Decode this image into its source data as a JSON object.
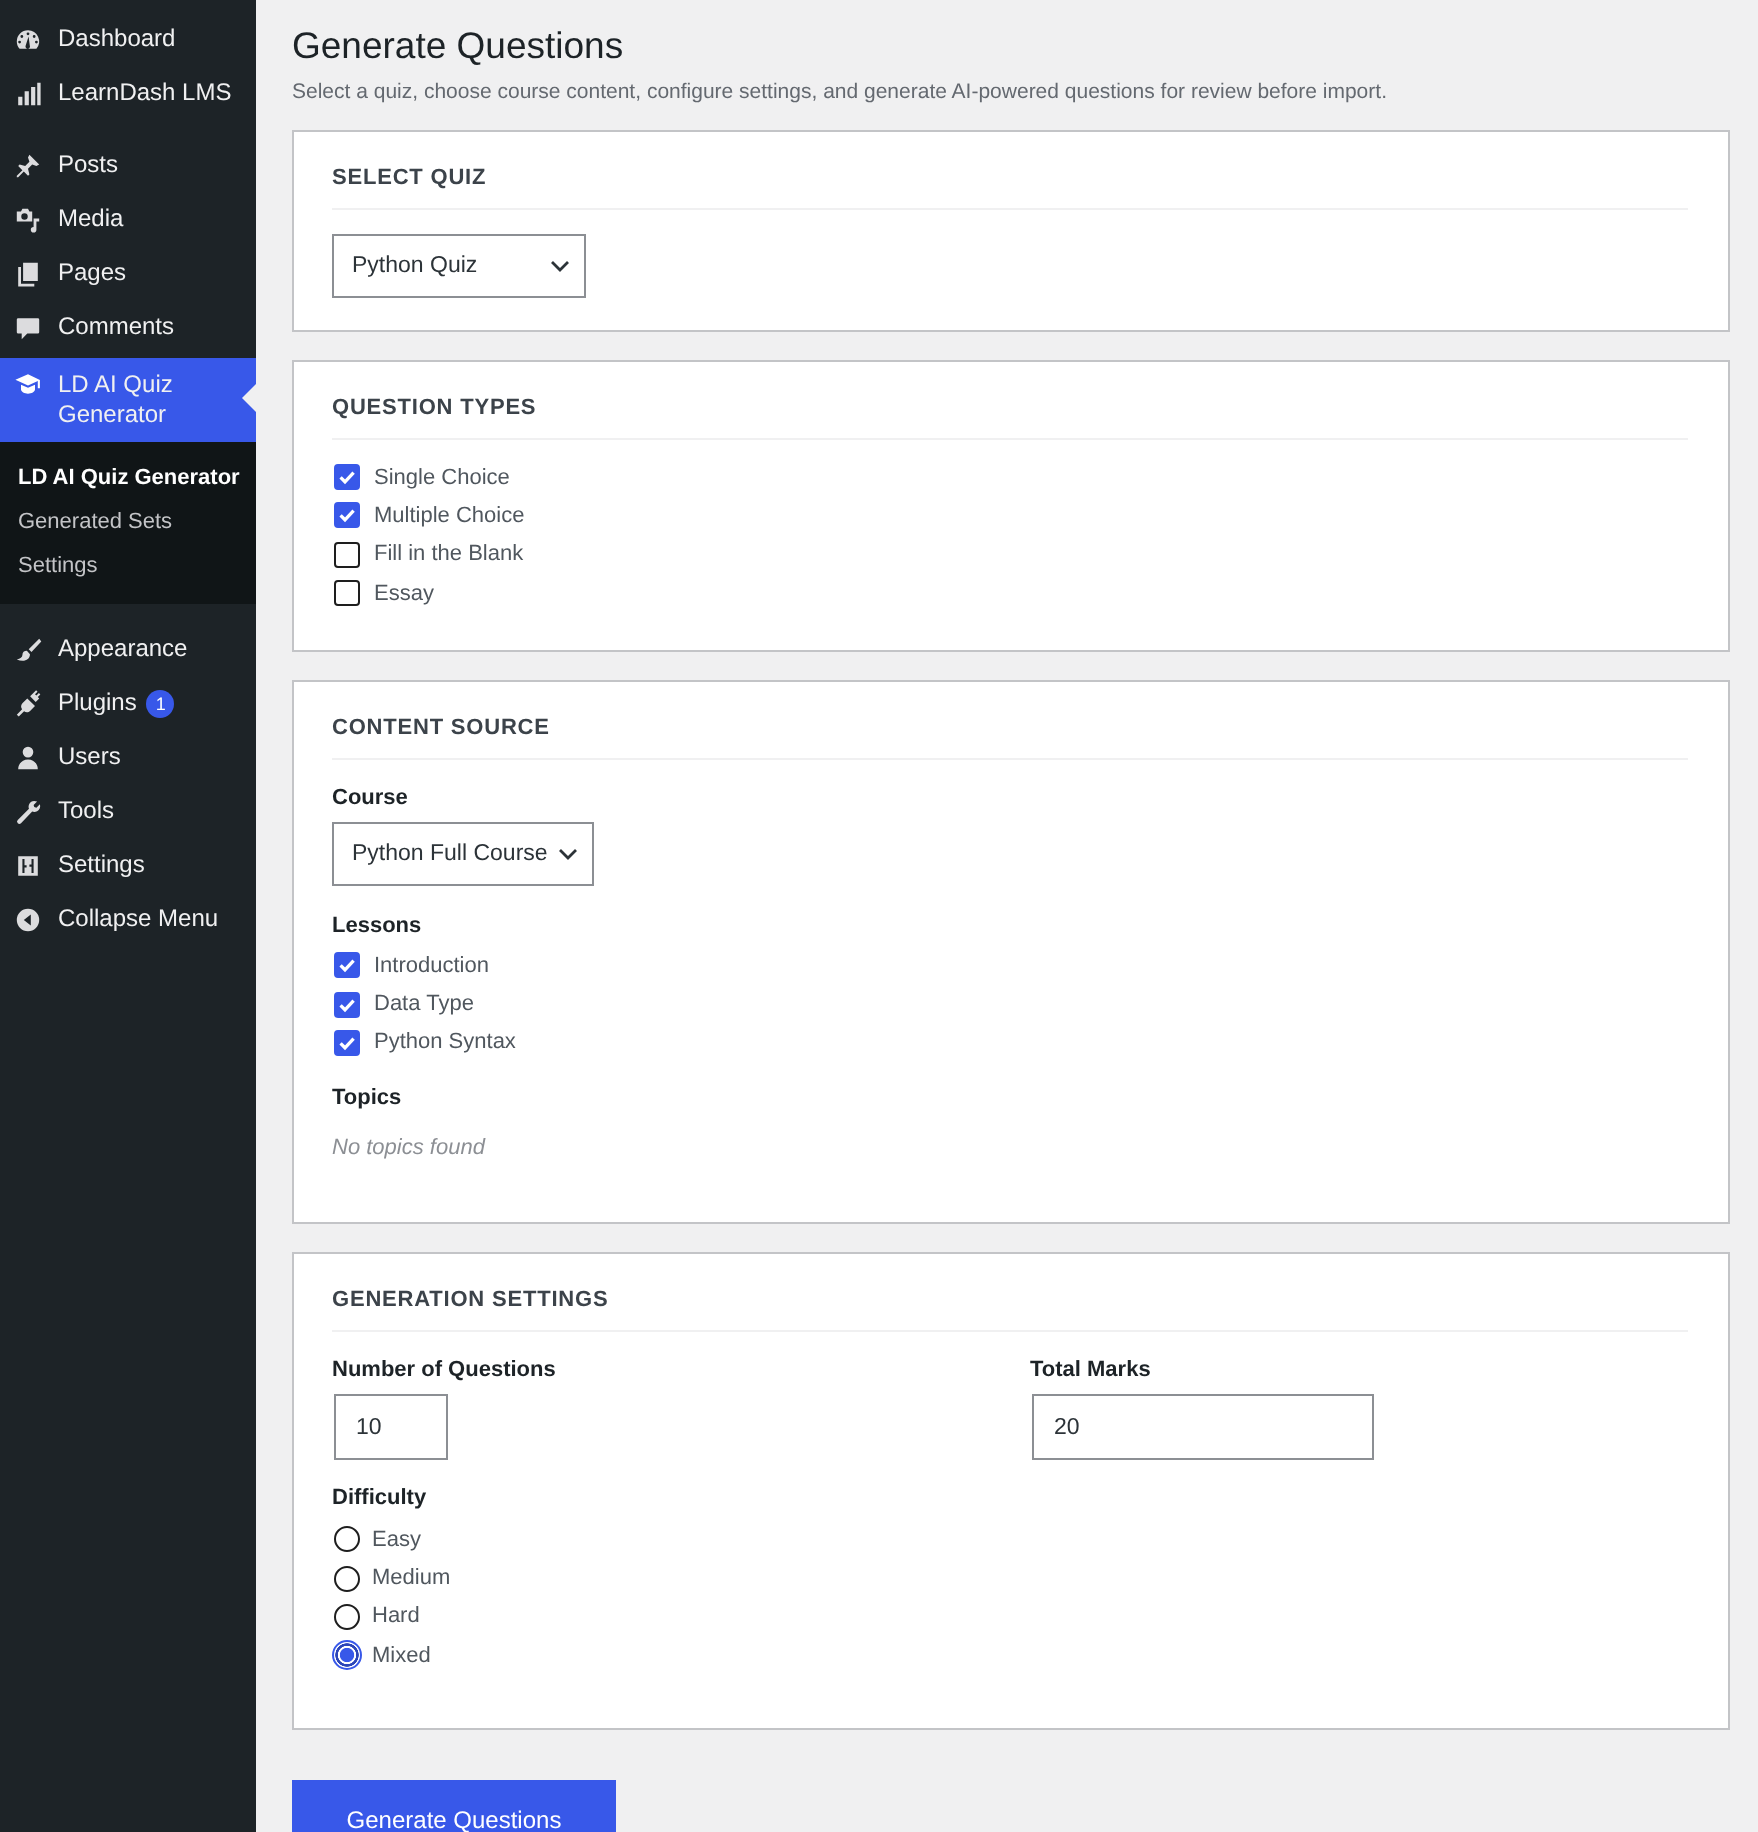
{
  "sidebar": {
    "groups": [
      {
        "items": [
          {
            "label": "Dashboard",
            "selected": false
          },
          {
            "label": "LearnDash LMS",
            "selected": false
          }
        ]
      },
      {
        "items": [
          {
            "label": "Posts",
            "selected": false
          },
          {
            "label": "Media",
            "selected": false
          },
          {
            "label": "Pages",
            "selected": false
          },
          {
            "label": "Comments",
            "selected": false
          },
          {
            "label": "LD AI Quiz Generator",
            "selected": true,
            "submenu": [
              {
                "label": "LD AI Quiz Generator",
                "selected": true
              },
              {
                "label": "Generated Sets",
                "selected": false
              },
              {
                "label": "Settings",
                "selected": false
              }
            ]
          }
        ]
      },
      {
        "items": [
          {
            "label": "Appearance",
            "selected": false
          },
          {
            "label": "Plugins",
            "selected": false,
            "badge": "1"
          },
          {
            "label": "Users",
            "selected": false
          },
          {
            "label": "Tools",
            "selected": false
          },
          {
            "label": "Settings",
            "selected": false
          },
          {
            "label": "Collapse Menu",
            "selected": false
          }
        ]
      }
    ]
  },
  "page": {
    "title": "Generate Questions",
    "description": "Select a quiz, choose course content, configure settings, and generate AI-powered questions for review before import."
  },
  "select_quiz": {
    "heading": "SELECT QUIZ",
    "dropdown": {
      "value": "Python Quiz"
    }
  },
  "question_types": {
    "heading": "QUESTION TYPES",
    "options": [
      {
        "label": "Single Choice",
        "checked": true
      },
      {
        "label": "Multiple Choice",
        "checked": true
      },
      {
        "label": "Fill in the Blank",
        "checked": false
      },
      {
        "label": "Essay",
        "checked": false
      }
    ]
  },
  "content_source": {
    "heading": "CONTENT SOURCE",
    "course_label": "Course",
    "course_dropdown": {
      "value": "Python Full Course"
    },
    "lessons_label": "Lessons",
    "lessons": [
      {
        "label": "Introduction",
        "checked": true
      },
      {
        "label": "Data Type",
        "checked": true
      },
      {
        "label": "Python Syntax",
        "checked": true
      }
    ],
    "topics_label": "Topics",
    "topics_empty": "No topics found"
  },
  "generation_settings": {
    "heading": "GENERATION SETTINGS",
    "fields": [
      {
        "label": "Number of Questions",
        "value": "10"
      },
      {
        "label": "Total Marks",
        "value": "20"
      }
    ],
    "difficulty_label": "Difficulty",
    "difficulty": [
      {
        "label": "Easy",
        "selected": false
      },
      {
        "label": "Medium",
        "selected": false
      },
      {
        "label": "Hard",
        "selected": false
      },
      {
        "label": "Mixed",
        "selected": true
      }
    ]
  },
  "submit_button": {
    "label": "Generate Questions"
  }
}
